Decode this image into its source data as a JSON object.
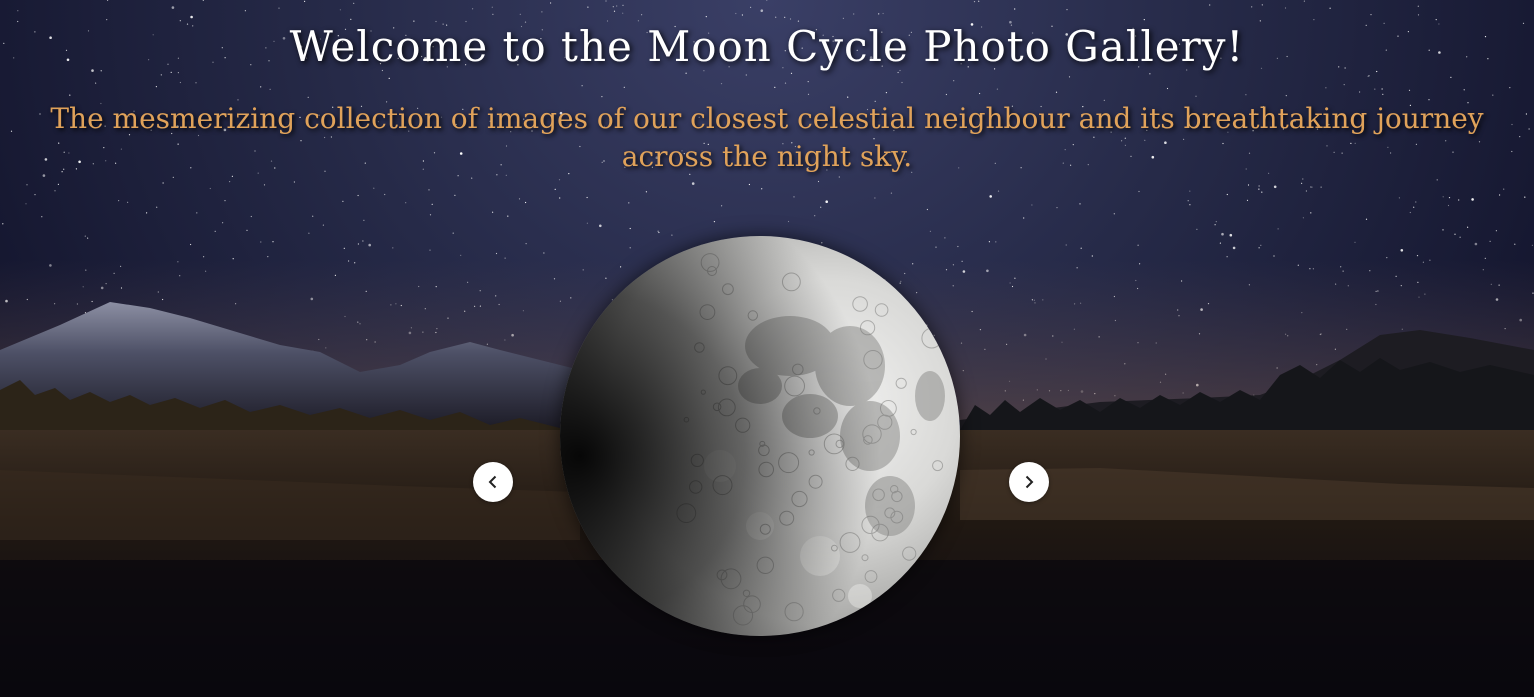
{
  "header": {
    "title": "Welcome to the Moon Cycle Photo Gallery!",
    "subtitle": "The mesmerizing collection of images of our closest celestial neighbour and its breathtaking journey across the night sky."
  },
  "carousel": {
    "prev_icon": "chevron-left-icon",
    "next_icon": "chevron-right-icon",
    "current_image": "waxing-gibbous-moon"
  },
  "colors": {
    "title": "#ffffff",
    "subtitle": "#e0a25a",
    "button_bg": "#ffffff",
    "button_icon": "#222222"
  }
}
